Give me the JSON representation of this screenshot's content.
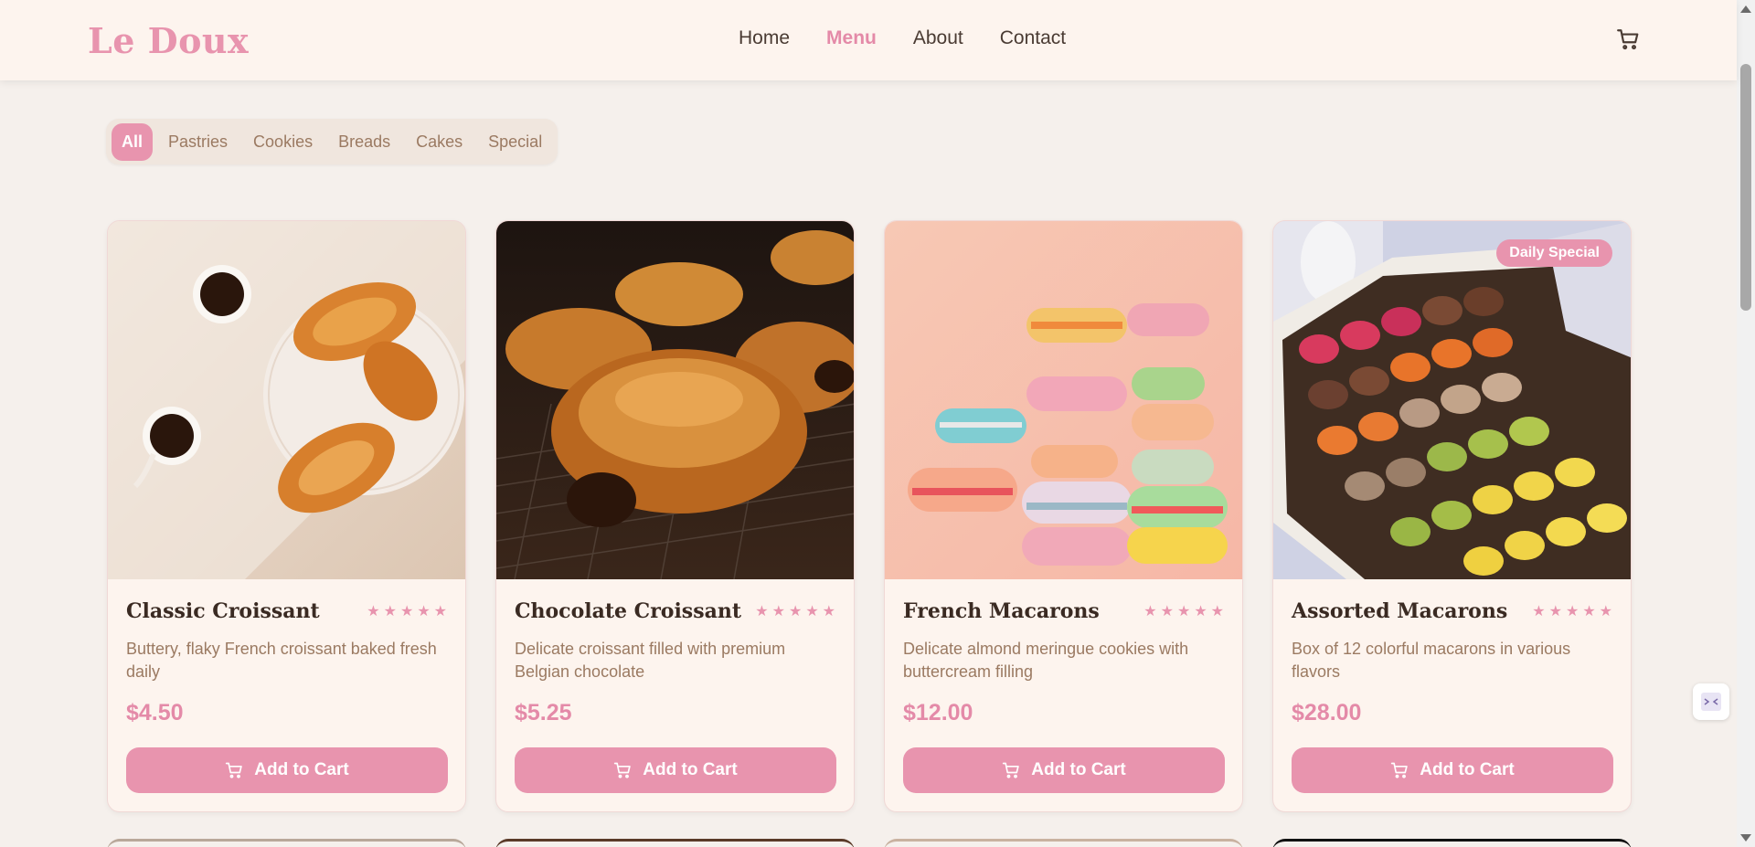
{
  "brand": {
    "name": "Le Doux",
    "accent": "#e894ae"
  },
  "nav": {
    "items": [
      {
        "label": "Home",
        "active": false
      },
      {
        "label": "Menu",
        "active": true
      },
      {
        "label": "About",
        "active": false
      },
      {
        "label": "Contact",
        "active": false
      }
    ],
    "cart_icon": "cart-icon"
  },
  "filters": {
    "items": [
      {
        "label": "All",
        "active": true
      },
      {
        "label": "Pastries",
        "active": false
      },
      {
        "label": "Cookies",
        "active": false
      },
      {
        "label": "Breads",
        "active": false
      },
      {
        "label": "Cakes",
        "active": false
      },
      {
        "label": "Special",
        "active": false
      }
    ]
  },
  "products": [
    {
      "title": "Classic Croissant",
      "description": "Buttery, flaky French croissant baked fresh daily",
      "price": "$4.50",
      "rating": 5,
      "button": "Add to Cart",
      "badge": "",
      "image": "croissants-with-coffee"
    },
    {
      "title": "Chocolate Croissant",
      "description": "Delicate croissant filled with premium Belgian chocolate",
      "price": "$5.25",
      "rating": 5,
      "button": "Add to Cart",
      "badge": "",
      "image": "chocolate-croissants-on-rack"
    },
    {
      "title": "French Macarons",
      "description": "Delicate almond meringue cookies with buttercream filling",
      "price": "$12.00",
      "rating": 5,
      "button": "Add to Cart",
      "badge": "",
      "image": "stacked-macarons"
    },
    {
      "title": "Assorted Macarons",
      "description": "Box of 12 colorful macarons in various flavors",
      "price": "$28.00",
      "rating": 5,
      "button": "Add to Cart",
      "badge": "Daily Special",
      "image": "macaron-box"
    }
  ]
}
